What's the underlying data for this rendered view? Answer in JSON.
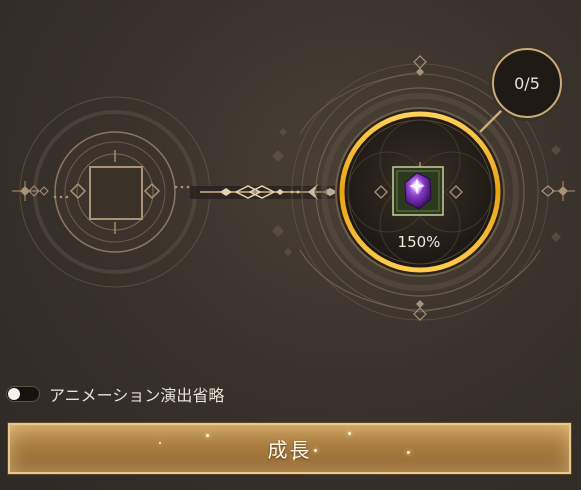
{
  "upgrade": {
    "counter": "0/5",
    "multiplier": "150%",
    "gem": "purple-gem-icon"
  },
  "settings": {
    "skip_animation_label": "アニメーション演出省略",
    "skip_animation_on": false
  },
  "actions": {
    "grow_label": "成長"
  },
  "colors": {
    "gold": "#c9ac7a",
    "ring_highlight": "#f2b31c",
    "gem_purple": "#7a2fb5",
    "button_gold": "#a97d40"
  }
}
